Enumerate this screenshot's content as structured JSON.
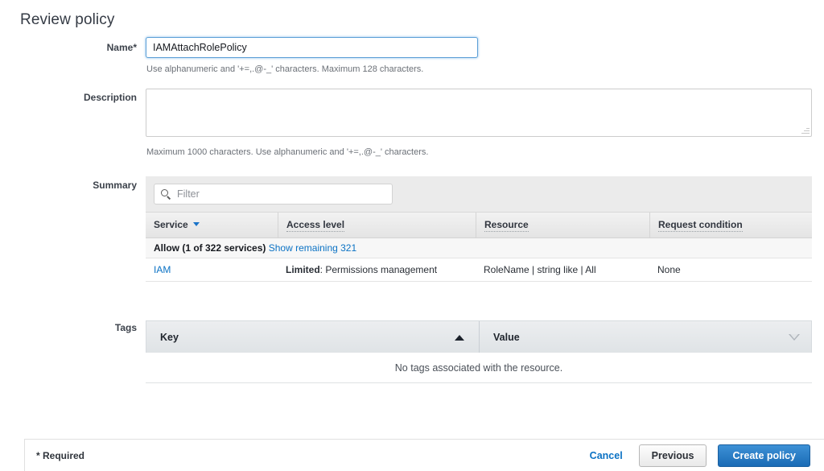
{
  "page": {
    "title": "Review policy"
  },
  "name_field": {
    "label": "Name*",
    "value": "IAMAttachRolePolicy",
    "placeholder": "",
    "hint": "Use alphanumeric and '+=,.@-_' characters. Maximum 128 characters."
  },
  "description_field": {
    "label": "Description",
    "value": "",
    "placeholder": "",
    "hint": "Maximum 1000 characters. Use alphanumeric and '+=,.@-_' characters."
  },
  "summary": {
    "label": "Summary",
    "filter_placeholder": "Filter",
    "filter_value": "",
    "columns": [
      {
        "label": "Service",
        "sorted": true,
        "sort_dir": "desc"
      },
      {
        "label": "Access level",
        "sorted": false,
        "sort_dir": ""
      },
      {
        "label": "Resource",
        "sorted": false,
        "sort_dir": ""
      },
      {
        "label": "Request condition",
        "sorted": false,
        "sort_dir": ""
      }
    ],
    "group_row": {
      "title": "Allow (1 of 322 services)",
      "show_remaining_link": "Show remaining 321"
    },
    "rows": [
      {
        "service": "IAM",
        "access_level_prefix": "Limited",
        "access_level": "Permissions management",
        "resource": "RoleName | string like | All",
        "request_condition": "None"
      }
    ]
  },
  "tags": {
    "label": "Tags",
    "columns": [
      {
        "label": "Key",
        "sort_dir": "asc"
      },
      {
        "label": "Value",
        "sort_dir": "desc"
      }
    ],
    "empty_message": "No tags associated with the resource."
  },
  "footer": {
    "required_note": "* Required",
    "cancel_label": "Cancel",
    "previous_label": "Previous",
    "create_label": "Create policy"
  },
  "colors": {
    "link": "#0b72c4",
    "primary_button": "#1a6bb5",
    "focus_border": "#5b9fd6",
    "sort_caret": "#1a73c8"
  }
}
